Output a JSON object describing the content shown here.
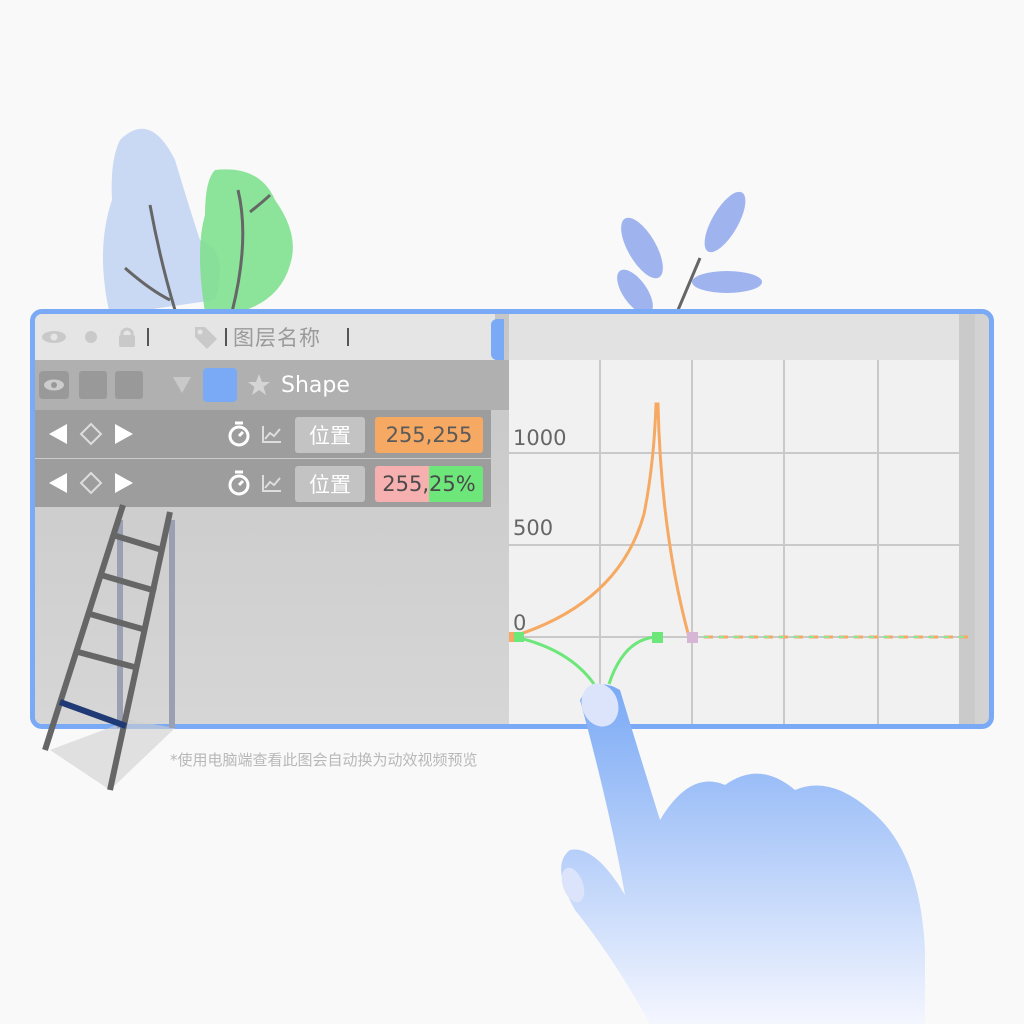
{
  "header": {
    "layer_name_label": "图层名称"
  },
  "layer": {
    "name": "Shape"
  },
  "properties": [
    {
      "label": "位置",
      "value": "255,255"
    },
    {
      "label": "位置",
      "value_left": "255,",
      "value_right": "25%"
    }
  ],
  "graph": {
    "tick_labels": [
      "1000",
      "500",
      "0"
    ]
  },
  "footnote": "*使用电脑端查看此图会自动换为动效视频预览",
  "colors": {
    "accent": "#7aa9f5",
    "orange": "#f6a963",
    "green": "#6ee77a",
    "pink": "#f7b0b0"
  },
  "icons": [
    "eye-icon",
    "dot-icon",
    "lock-icon",
    "tag-icon",
    "triangle-down-icon",
    "star-icon",
    "prev-keyframe-icon",
    "keyframe-diamond-icon",
    "next-keyframe-icon",
    "stopwatch-icon",
    "graph-icon"
  ]
}
